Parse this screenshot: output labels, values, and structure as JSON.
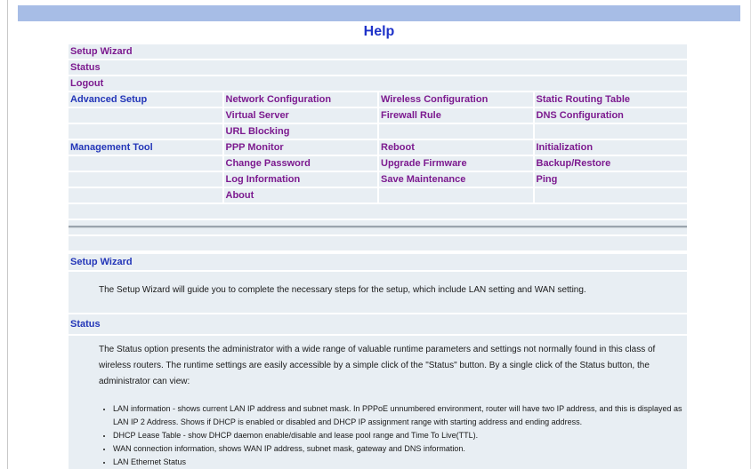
{
  "header": {
    "title": "Help"
  },
  "nav": {
    "rows": [
      [
        "Setup Wizard",
        "",
        "",
        ""
      ],
      [
        "Status",
        "",
        "",
        ""
      ],
      [
        "Logout",
        "",
        "",
        ""
      ],
      [
        "Advanced Setup",
        "Network Configuration",
        "Wireless Configuration",
        "Static Routing Table"
      ],
      [
        "",
        "Virtual Server",
        "Firewall Rule",
        "DNS Configuration"
      ],
      [
        "",
        "URL Blocking",
        "",
        ""
      ],
      [
        "Management Tool",
        "PPP Monitor",
        "Reboot",
        "Initialization"
      ],
      [
        "",
        "Change Password",
        "Upgrade Firmware",
        "Backup/Restore"
      ],
      [
        "",
        "Log Information",
        "Save Maintenance",
        "Ping"
      ],
      [
        "",
        "About",
        "",
        ""
      ],
      [
        "",
        "",
        "",
        ""
      ]
    ]
  },
  "sections": {
    "setup_wizard": {
      "title": "Setup Wizard",
      "body": "The Setup Wizard will guide you to complete the necessary steps for the setup, which include LAN setting and WAN setting."
    },
    "status": {
      "title": "Status",
      "body": "The Status option presents the administrator with a wide range of valuable runtime parameters and settings not normally found in this class of wireless routers. The runtime settings are easily accessible by a simple click of the \"Status\" button. By a single click of the Status button, the administrator can view:",
      "bullets": [
        "LAN information - shows current LAN IP address and subnet mask. In PPPoE unnumbered environment, router will have two IP address, and this is displayed as LAN IP 2 Address. Shows if DHCP is enabled or disabled and DHCP IP assignment range with starting address and ending address.",
        "DHCP Lease Table - show DHCP daemon enable/disable and lease pool range and Time To Live(TTL).",
        "WAN connection information, shows WAN IP address, subnet mask, gateway and DNS information.",
        "LAN Ethernet Status"
      ]
    }
  }
}
